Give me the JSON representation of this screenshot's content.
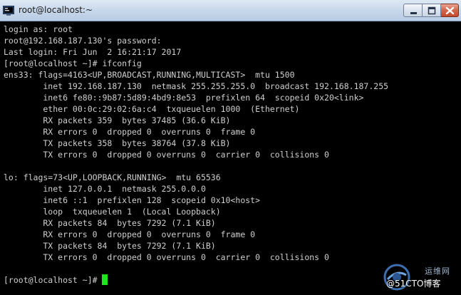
{
  "window": {
    "title": "root@localhost:~"
  },
  "terminal": {
    "lines": [
      "login as: root",
      "root@192.168.187.130's password:",
      "Last login: Fri Jun  2 16:21:17 2017",
      "[root@localhost ~]# ifconfig",
      "ens33: flags=4163<UP,BROADCAST,RUNNING,MULTICAST>  mtu 1500",
      "        inet 192.168.187.130  netmask 255.255.255.0  broadcast 192.168.187.255",
      "        inet6 fe80::9b87:5d89:4bd9:8e53  prefixlen 64  scopeid 0x20<link>",
      "        ether 00:0c:29:02:6a:c4  txqueuelen 1000  (Ethernet)",
      "        RX packets 359  bytes 37485 (36.6 KiB)",
      "        RX errors 0  dropped 0  overruns 0  frame 0",
      "        TX packets 358  bytes 38764 (37.8 KiB)",
      "        TX errors 0  dropped 0 overruns 0  carrier 0  collisions 0",
      "",
      "lo: flags=73<UP,LOOPBACK,RUNNING>  mtu 65536",
      "        inet 127.0.0.1  netmask 255.0.0.0",
      "        inet6 ::1  prefixlen 128  scopeid 0x10<host>",
      "        loop  txqueuelen 1  (Local Loopback)",
      "        RX packets 84  bytes 7292 (7.1 KiB)",
      "        RX errors 0  dropped 0  overruns 0  frame 0",
      "        TX packets 84  bytes 7292 (7.1 KiB)",
      "        TX errors 0  dropped 0 overruns 0  carrier 0  collisions 0",
      "",
      "[root@localhost ~]# "
    ],
    "cursor_color": "#18e818",
    "text_color": "#cfcfcf",
    "background": "#000000"
  },
  "watermark": {
    "top_text": "运维网",
    "bottom_text": "@51CTO博客"
  },
  "icons": {
    "app": "putty-terminal-icon",
    "minimize": "minimize-icon",
    "maximize": "maximize-icon",
    "close": "close-icon"
  }
}
